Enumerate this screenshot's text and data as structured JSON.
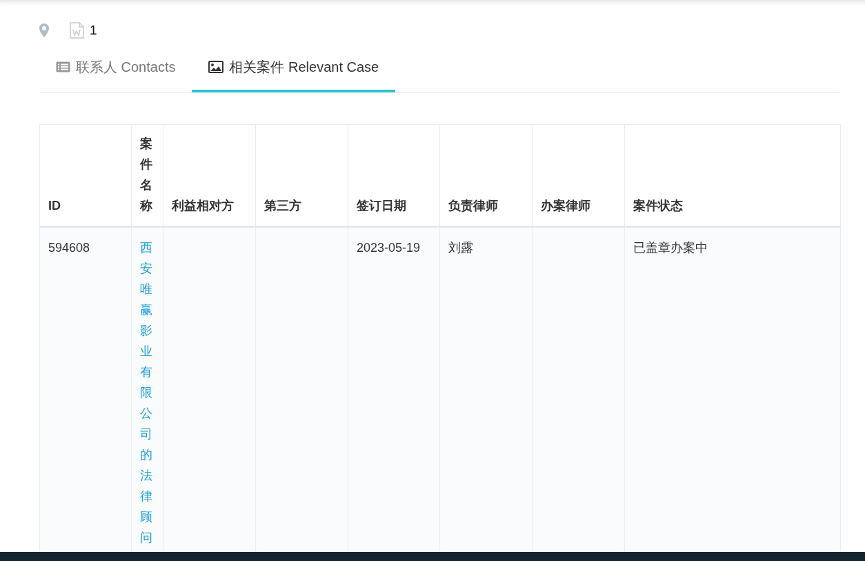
{
  "header": {
    "attachment_count": "1"
  },
  "tabs": [
    {
      "label": "联系人 Contacts",
      "kind": "list",
      "selected": false
    },
    {
      "label": "相关案件 Relevant Case",
      "kind": "image",
      "selected": true
    }
  ],
  "table": {
    "columns": [
      "ID",
      "案件名称",
      "利益相对方",
      "第三方",
      "签订日期",
      "负责律师",
      "办案律师",
      "案件状态"
    ],
    "rows": [
      {
        "id": "594608",
        "case_name": "西安唯赢影业有限公司的法律顾问",
        "signing_date": "2023-05-19",
        "lead_lawyer": "刘露",
        "status": "已盖章办案中"
      }
    ]
  }
}
